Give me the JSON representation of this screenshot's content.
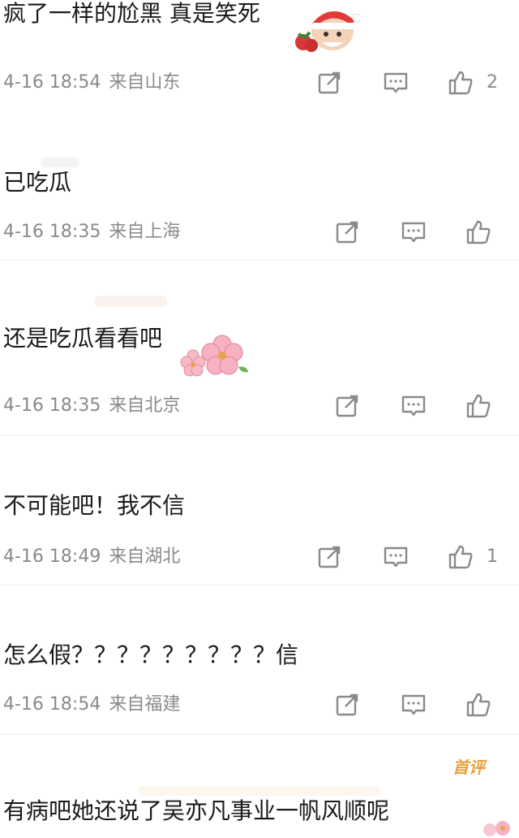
{
  "comments": [
    {
      "text": "疯了一样的尬黑 真是笑死",
      "time": "4-16 18:54",
      "location": "来自山东",
      "likes": "2"
    },
    {
      "text": "已吃瓜",
      "time": "4-16 18:35",
      "location": "来自上海",
      "likes": ""
    },
    {
      "text": "还是吃瓜看看吧",
      "time": "4-16 18:35",
      "location": "来自北京",
      "likes": ""
    },
    {
      "text": "不可能吧！我不信",
      "time": "4-16 18:49",
      "location": "来自湖北",
      "likes": "1"
    },
    {
      "text": "怎么假？？？？？？？？？信",
      "time": "4-16 18:54",
      "location": "来自福建",
      "likes": ""
    },
    {
      "text": "有病吧她还说了吴亦凡事业一帆风顺呢",
      "badge": "首评"
    }
  ],
  "icons": {
    "share": "share-icon",
    "comment": "comment-icon",
    "like": "thumbs-up-icon",
    "emoji_santa": "santa-emoji-icon",
    "emoji_flower": "flower-emoji-icon"
  },
  "colors": {
    "text": "#1a1a1a",
    "meta": "#8a8a8a",
    "icon": "#8a8a8a",
    "badge": "#e6a23c"
  }
}
